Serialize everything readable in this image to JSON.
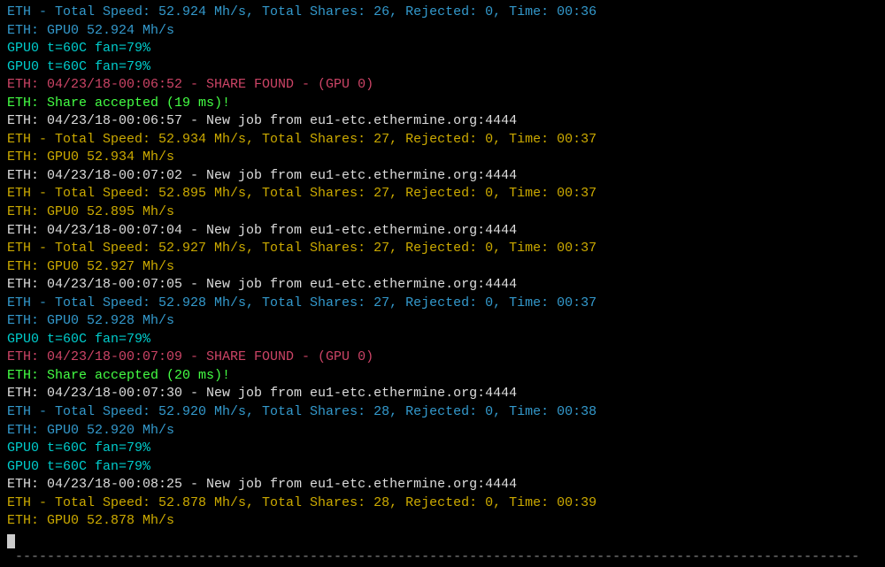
{
  "lines": [
    {
      "cls": "blue",
      "text": "ETH - Total Speed: 52.924 Mh/s, Total Shares: 26, Rejected: 0, Time: 00:36"
    },
    {
      "cls": "blue",
      "text": "ETH: GPU0 52.924 Mh/s"
    },
    {
      "cls": "cyan",
      "text": "GPU0 t=60C fan=79%"
    },
    {
      "cls": "cyan",
      "text": "GPU0 t=60C fan=79%"
    },
    {
      "cls": "magenta",
      "text": "ETH: 04/23/18-00:06:52 - SHARE FOUND - (GPU 0)"
    },
    {
      "cls": "green",
      "text": "ETH: Share accepted (19 ms)!"
    },
    {
      "cls": "white",
      "text": "ETH: 04/23/18-00:06:57 - New job from eu1-etc.ethermine.org:4444"
    },
    {
      "cls": "yellow",
      "text": "ETH - Total Speed: 52.934 Mh/s, Total Shares: 27, Rejected: 0, Time: 00:37"
    },
    {
      "cls": "yellow",
      "text": "ETH: GPU0 52.934 Mh/s"
    },
    {
      "cls": "white",
      "text": "ETH: 04/23/18-00:07:02 - New job from eu1-etc.ethermine.org:4444"
    },
    {
      "cls": "yellow",
      "text": "ETH - Total Speed: 52.895 Mh/s, Total Shares: 27, Rejected: 0, Time: 00:37"
    },
    {
      "cls": "yellow",
      "text": "ETH: GPU0 52.895 Mh/s"
    },
    {
      "cls": "white",
      "text": "ETH: 04/23/18-00:07:04 - New job from eu1-etc.ethermine.org:4444"
    },
    {
      "cls": "yellow",
      "text": "ETH - Total Speed: 52.927 Mh/s, Total Shares: 27, Rejected: 0, Time: 00:37"
    },
    {
      "cls": "yellow",
      "text": "ETH: GPU0 52.927 Mh/s"
    },
    {
      "cls": "white",
      "text": "ETH: 04/23/18-00:07:05 - New job from eu1-etc.ethermine.org:4444"
    },
    {
      "cls": "blue",
      "text": "ETH - Total Speed: 52.928 Mh/s, Total Shares: 27, Rejected: 0, Time: 00:37"
    },
    {
      "cls": "blue",
      "text": "ETH: GPU0 52.928 Mh/s"
    },
    {
      "cls": "cyan",
      "text": "GPU0 t=60C fan=79%"
    },
    {
      "cls": "magenta",
      "text": "ETH: 04/23/18-00:07:09 - SHARE FOUND - (GPU 0)"
    },
    {
      "cls": "green",
      "text": "ETH: Share accepted (20 ms)!"
    },
    {
      "cls": "white",
      "text": "ETH: 04/23/18-00:07:30 - New job from eu1-etc.ethermine.org:4444"
    },
    {
      "cls": "blue",
      "text": "ETH - Total Speed: 52.920 Mh/s, Total Shares: 28, Rejected: 0, Time: 00:38"
    },
    {
      "cls": "blue",
      "text": "ETH: GPU0 52.920 Mh/s"
    },
    {
      "cls": "cyan",
      "text": "GPU0 t=60C fan=79%"
    },
    {
      "cls": "cyan",
      "text": "GPU0 t=60C fan=79%"
    },
    {
      "cls": "white",
      "text": "ETH: 04/23/18-00:08:25 - New job from eu1-etc.ethermine.org:4444"
    },
    {
      "cls": "yellow",
      "text": "ETH - Total Speed: 52.878 Mh/s, Total Shares: 28, Rejected: 0, Time: 00:39"
    },
    {
      "cls": "yellow",
      "text": "ETH: GPU0 52.878 Mh/s"
    }
  ],
  "separator": " ----------------------------------------------------------------------------------------------------------"
}
